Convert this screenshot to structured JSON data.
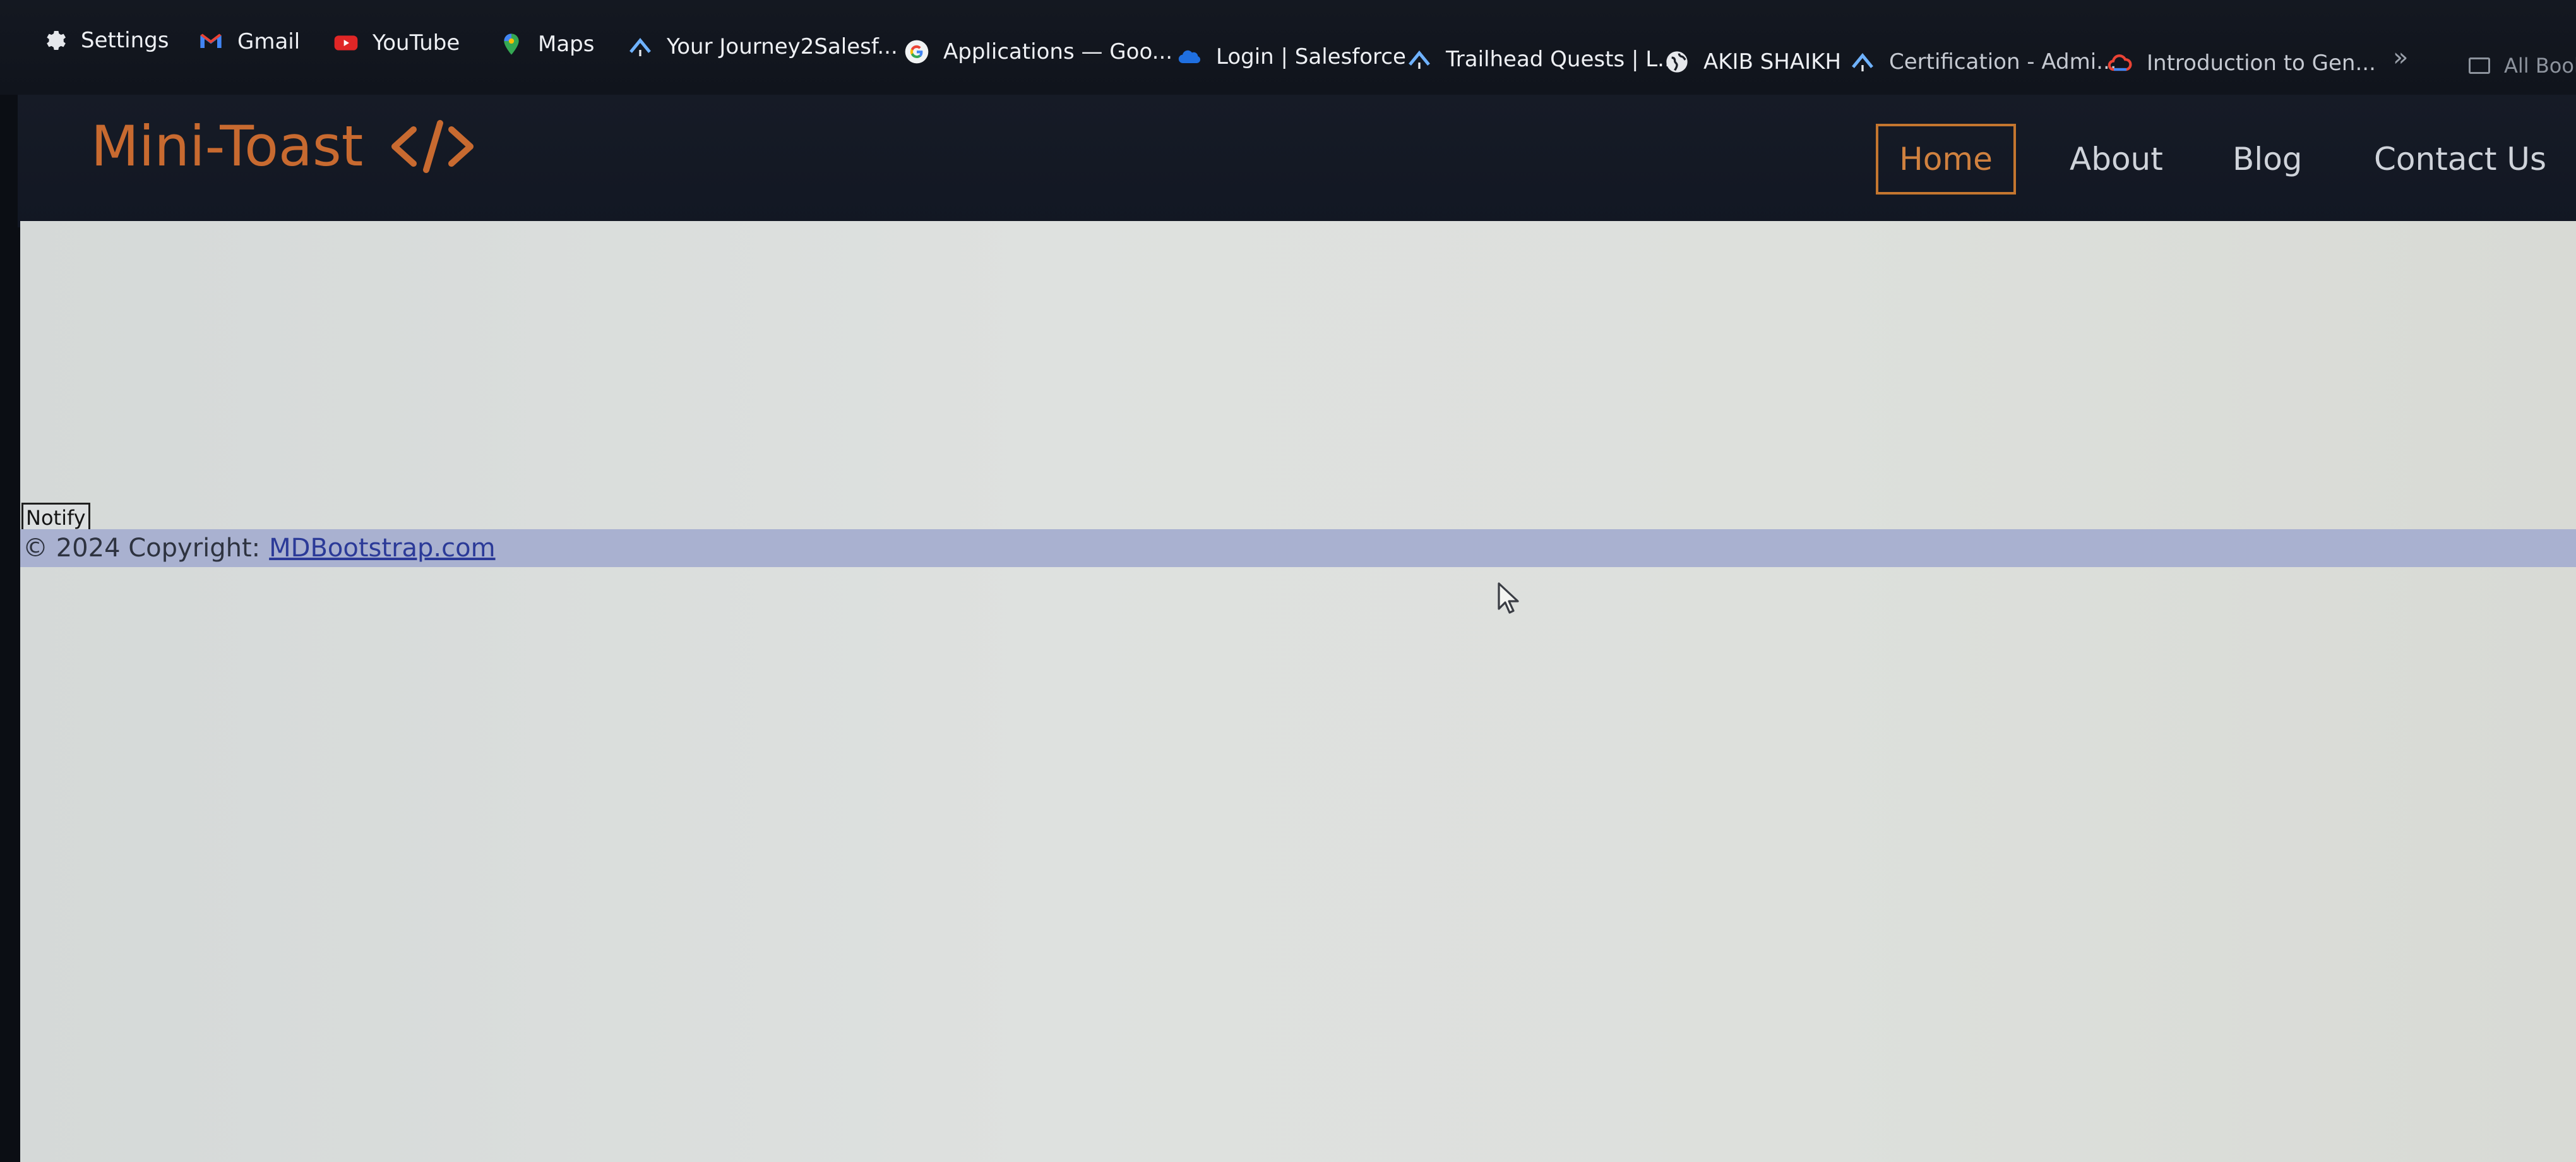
{
  "bookmarks_bar": {
    "items": [
      {
        "label": "Settings",
        "icon": "gear-icon"
      },
      {
        "label": "Gmail",
        "icon": "gmail-icon"
      },
      {
        "label": "YouTube",
        "icon": "youtube-icon"
      },
      {
        "label": "Maps",
        "icon": "maps-icon"
      },
      {
        "label": "Your Journey2Salesf...",
        "icon": "trailhead-icon"
      },
      {
        "label": "Applications — Goo...",
        "icon": "google-icon"
      },
      {
        "label": "Login | Salesforce",
        "icon": "salesforce-cloud-icon"
      },
      {
        "label": "Trailhead Quests | L...",
        "icon": "trailhead-icon"
      },
      {
        "label": "AKIB SHAIKH",
        "icon": "globe-icon"
      },
      {
        "label": "Certification - Admi...",
        "icon": "trailhead-icon"
      },
      {
        "label": "Introduction to Gen...",
        "icon": "google-cloud-icon"
      }
    ],
    "overflow_label": "»",
    "all_bookmarks_label": "All Book"
  },
  "navbar": {
    "brand": "Mini-Toast",
    "brand_icon": "code-brackets-icon",
    "links": [
      {
        "label": "Home",
        "active": true
      },
      {
        "label": "About",
        "active": false
      },
      {
        "label": "Blog",
        "active": false
      },
      {
        "label": "Contact Us",
        "active": false
      }
    ]
  },
  "main": {
    "notify_button_label": "Notify"
  },
  "footer": {
    "text": "© 2024 Copyright:",
    "link_text": "MDBootstrap.com"
  },
  "colors": {
    "brand_orange": "#c86a30",
    "nav_background": "#141923",
    "page_background": "#dcdfdc",
    "footer_background": "#a9b1d0",
    "footer_link": "#2b3a98"
  }
}
